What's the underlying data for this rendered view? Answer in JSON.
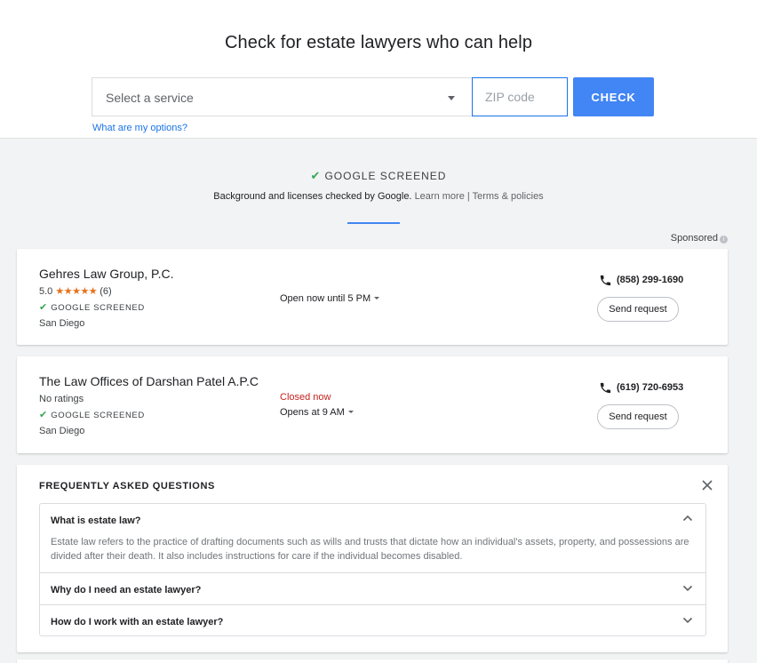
{
  "search": {
    "title": "Check for estate lawyers who can help",
    "service_placeholder": "Select a service",
    "zip_placeholder": "ZIP code",
    "check_label": "CHECK",
    "options_link": "What are my options?"
  },
  "screened": {
    "heading": "GOOGLE SCREENED",
    "sub_text": "Background and licenses checked by Google.",
    "learn_more": "Learn more",
    "separator": "|",
    "terms": "Terms & policies"
  },
  "sponsored_label": "Sponsored",
  "listings": [
    {
      "name": "Gehres Law Group, P.C.",
      "rating_value": "5.0",
      "stars": "★★★★★",
      "review_count": "(6)",
      "badge": "GOOGLE SCREENED",
      "city": "San Diego",
      "hours": "Open now until 5 PM",
      "phone": "(858) 299-1690",
      "button": "Send request"
    },
    {
      "name": "The Law Offices of Darshan Patel A.P.C",
      "rating_text": "No ratings",
      "badge": "GOOGLE SCREENED",
      "city": "San Diego",
      "status": "Closed now",
      "hours": "Opens at 9 AM",
      "phone": "(619) 720-6953",
      "button": "Send request"
    }
  ],
  "faq": {
    "title": "FREQUENTLY ASKED QUESTIONS",
    "items": [
      {
        "question": "What is estate law?",
        "answer": "Estate law refers to the practice of drafting documents such as wills and trusts that dictate how an individual's assets, property, and possessions are divided after their death. It also includes instructions for care if the individual becomes disabled.",
        "expanded": true
      },
      {
        "question": "Why do I need an estate lawyer?",
        "expanded": false
      },
      {
        "question": "How do I work with an estate lawyer?",
        "expanded": false
      }
    ]
  },
  "colors": {
    "accent": "#4285f4",
    "link": "#1a73e8",
    "check_green": "#34a853",
    "star_orange": "#e7711b",
    "closed_red": "#c5221f"
  },
  "icons": [
    "checkmark-icon",
    "info-icon",
    "phone-icon",
    "dropdown-caret-icon",
    "close-icon",
    "chevron-up-icon",
    "chevron-down-icon"
  ]
}
